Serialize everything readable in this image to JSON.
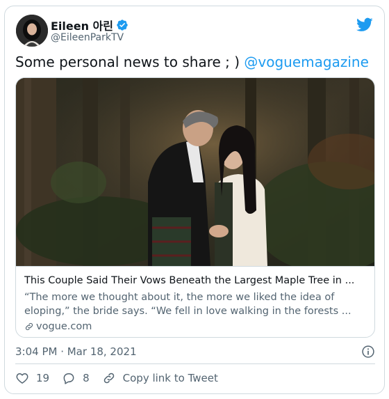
{
  "author": {
    "display_name": "Eileen 아린",
    "handle": "@EileenParkTV",
    "verified": true,
    "avatar_icon": "avatar"
  },
  "tweet": {
    "text": "Some personal news to share ; ) ",
    "mention": "@voguemagazine"
  },
  "link_card": {
    "title": "This Couple Said Their Vows Beneath the Largest Maple Tree in ...",
    "description": "“The more we thought about it, the more we liked the idea of eloping,” the bride says. “We fell in love walking in the forests ...",
    "domain": "vogue.com"
  },
  "meta": {
    "timestamp": "3:04 PM · Mar 18, 2021"
  },
  "actions": {
    "likes": "19",
    "replies": "8",
    "copy_link": "Copy link to Tweet"
  },
  "colors": {
    "accent": "#1d9bf0",
    "text": "#0f1419",
    "muted": "#536471",
    "border": "#cfd9de"
  }
}
